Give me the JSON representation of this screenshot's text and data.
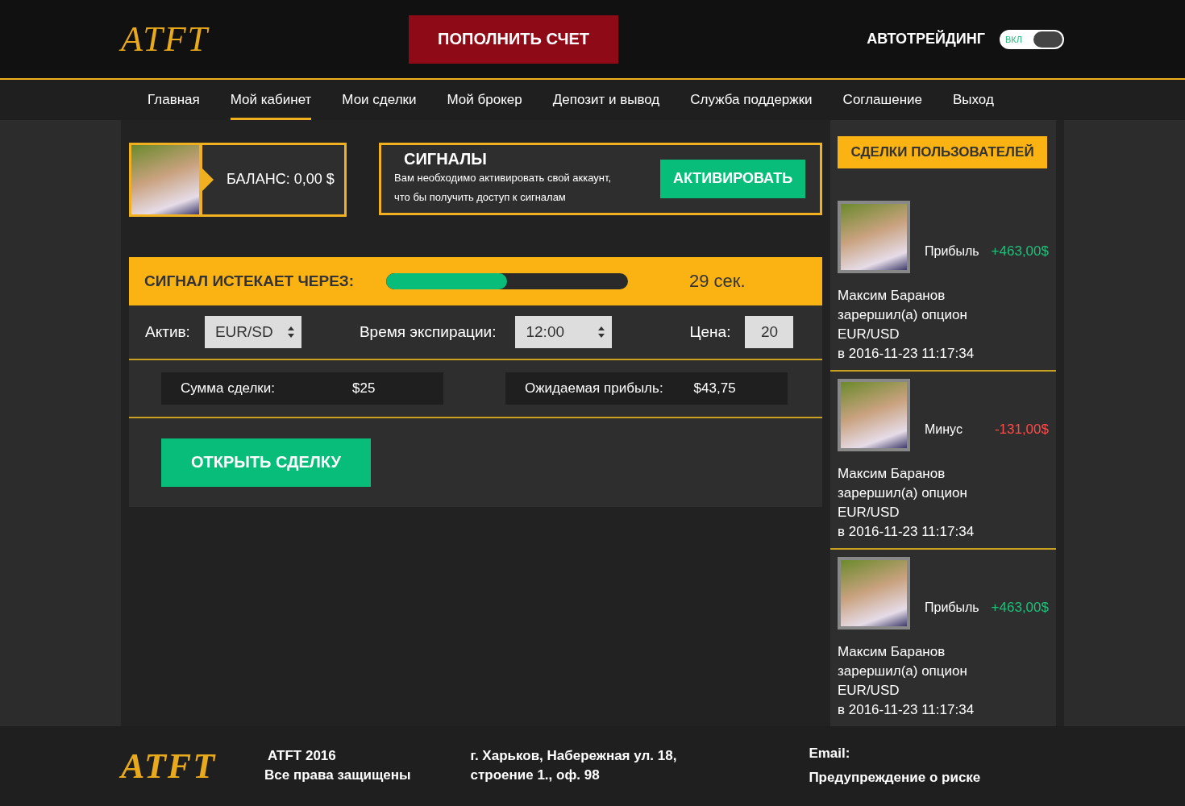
{
  "header": {
    "logo": "ATFT",
    "deposit_button": "ПОПОЛНИТЬ СЧЕТ",
    "autotrading": {
      "label": "АВТОТРЕЙДИНГ",
      "toggle_text": "ВКЛ",
      "on": true
    }
  },
  "nav": [
    {
      "label": "Главная",
      "selected": false
    },
    {
      "label": "Мой кабинет",
      "selected": true
    },
    {
      "label": "Мои сделки",
      "selected": false
    },
    {
      "label": "Мой брокер",
      "selected": false
    },
    {
      "label": "Депозит и вывод",
      "selected": false
    },
    {
      "label": "Служба поддержки",
      "selected": false
    },
    {
      "label": "Соглашение",
      "selected": false
    },
    {
      "label": "Выход",
      "selected": false
    }
  ],
  "balance": {
    "label": "БАЛАНС: 0,00 $"
  },
  "signals": {
    "title": "СИГНАЛЫ",
    "text_line_1": "Вам необходимо активировать свой аккаунт,",
    "text_line_2": "что бы получить доступ к сигналам",
    "button": "АКТИВИРОВАТЬ"
  },
  "timer": {
    "label": "СИГНАЛ ИСТЕКАЕТ ЧЕРЕЗ:",
    "level": 0.5,
    "reading": "29 сек."
  },
  "form": {
    "asset_label": "Актив:",
    "asset_value": "EUR/SD",
    "expiry_label": "Время экспирации:",
    "expiry_value": "12:00",
    "price_label": "Цена:",
    "price_value": "20",
    "amount_label": "Сумма сделки:",
    "amount_value": "$25",
    "profit_label": "Ожидаемая прибыль:",
    "profit_value": "$43,75",
    "open_button": "ОТКРЫТЬ СДЕЛКУ"
  },
  "user_deals": {
    "title": "СДЕЛКИ ПОЛЬЗОВАТЕЛЕЙ",
    "items": [
      {
        "kind": "profit",
        "result_label": "Прибыль",
        "amount": "+463,00$",
        "name": "Максим Баранов",
        "action": "зарершил(а) опцион",
        "asset": "EUR/USD",
        "time": "в 2016-11-23 11:17:34"
      },
      {
        "kind": "loss",
        "result_label": "Минус",
        "amount": "-131,00$",
        "name": "Максим Баранов",
        "action": "зарершил(а) опцион",
        "asset": "EUR/USD",
        "time": "в 2016-11-23 11:17:34"
      },
      {
        "kind": "profit",
        "result_label": "Прибыль",
        "amount": "+463,00$",
        "name": "Максим Баранов",
        "action": "зарершил(а) опцион",
        "asset": "EUR/USD",
        "time": "в 2016-11-23 11:17:34"
      }
    ]
  },
  "footer": {
    "logo": "ATFT",
    "copyright_line_1": "ATFT 2016",
    "copyright_line_2": "Все права защищены",
    "address_line_1": "г. Харьков, Набережная ул. 18,",
    "address_line_2": "строение 1., оф. 98",
    "email_label": "Email:",
    "risk_link": "Предупреждение о риске"
  }
}
